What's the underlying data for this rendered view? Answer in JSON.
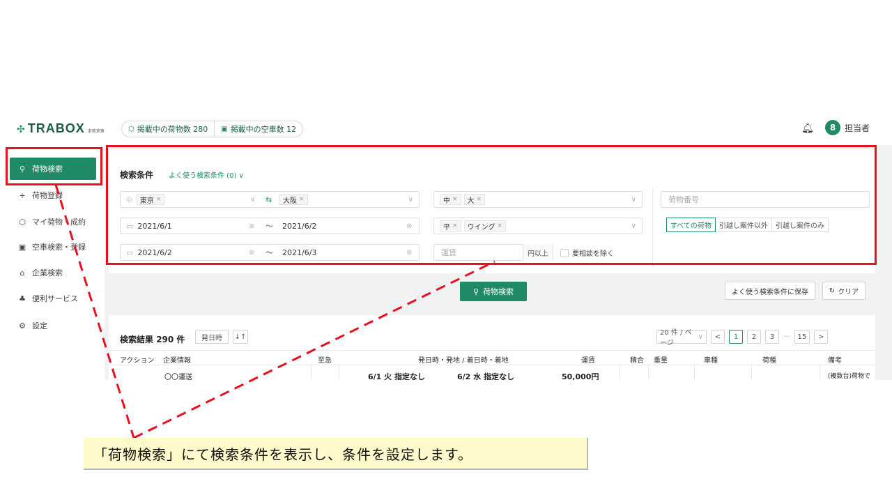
{
  "header": {
    "logo": "TRABOX",
    "logo_sub": "求荷求車",
    "stats": [
      {
        "icon": "box-icon",
        "label": "掲載中の荷物数 280"
      },
      {
        "icon": "truck-icon",
        "label": "掲載中の空車数 12"
      }
    ],
    "user_initial": "8",
    "user_name": "担当者"
  },
  "sidebar": {
    "items": [
      {
        "icon": "search-icon",
        "label": "荷物検索"
      },
      {
        "icon": "plus-icon",
        "label": "荷物登録"
      },
      {
        "icon": "box-icon",
        "label": "マイ荷物・成約"
      },
      {
        "icon": "truck-icon",
        "label": "空車検索・登録"
      },
      {
        "icon": "building-icon",
        "label": "企業検索"
      },
      {
        "icon": "people-icon",
        "label": "便利サービス"
      },
      {
        "icon": "gear-icon",
        "label": "設定"
      }
    ]
  },
  "search": {
    "title": "検索条件",
    "favorites": "よく使う検索条件 (0)",
    "from_tag": "東京",
    "to_tag": "大阪",
    "size_tags": [
      "中",
      "大"
    ],
    "type_tags": [
      "平",
      "ウイング"
    ],
    "date1_from": "2021/6/1",
    "date1_to": "2021/6/2",
    "date2_from": "2021/6/2",
    "date2_to": "2021/6/3",
    "tilde": "～",
    "fare_placeholder": "運賃",
    "fare_suffix": "円以上",
    "exclude_label": "要相談を除く",
    "cargo_no_placeholder": "荷物番号",
    "segments": [
      "すべての荷物",
      "引越し案件以外",
      "引越し案件のみ"
    ],
    "search_button": "荷物検索",
    "save_button": "よく使う検索条件に保存",
    "clear_button": "クリア"
  },
  "results": {
    "title": "検索結果",
    "count": "290 件",
    "sort_label": "発日時",
    "per_page": "20 件 / ページ",
    "pages": [
      "1",
      "2",
      "3"
    ],
    "ellipsis": "···",
    "last_page": "15",
    "columns": [
      "アクション",
      "企業情報",
      "至急",
      "発日時・発地 / 着日時・着地",
      "運賃",
      "積合",
      "重量",
      "車種",
      "荷種",
      "備考"
    ],
    "row": {
      "company": "〇〇運送",
      "depart": "6/1 火 指定なし",
      "arrive": "6/2 水 指定なし",
      "fare": "50,000円",
      "note": "(複数台)荷物で"
    }
  },
  "caption": "「荷物検索」にて検索条件を表示し、条件を設定します。",
  "colors": {
    "accent": "#1f8a64",
    "highlight": "#e8101e",
    "caption_bg": "#fffacc"
  }
}
